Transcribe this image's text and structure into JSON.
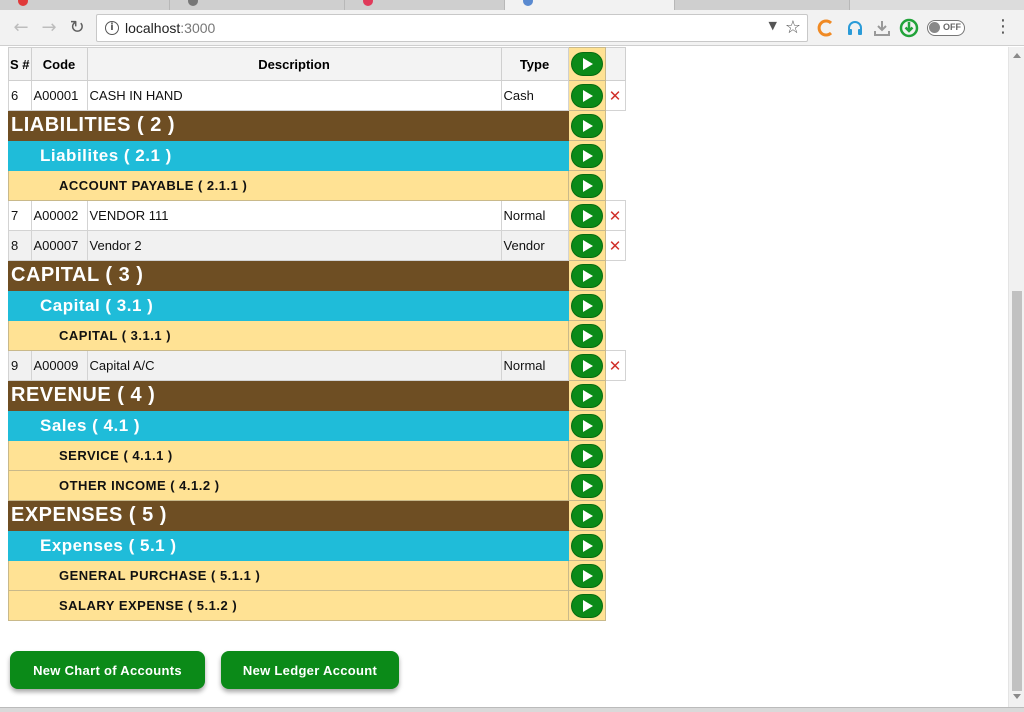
{
  "browser": {
    "url_host": "localhost",
    "url_port": ":3000",
    "toggle_label": "OFF"
  },
  "table": {
    "headers": {
      "sn": "S #",
      "code": "Code",
      "description": "Description",
      "type": "Type"
    },
    "rows": [
      {
        "kind": "account",
        "sn": "6",
        "code": "A00001",
        "description": "CASH IN HAND",
        "type": "Cash",
        "alt": false
      },
      {
        "kind": "level1",
        "label": "LIABILITIES ( 2 )"
      },
      {
        "kind": "level2",
        "label": "Liabilites ( 2.1 )"
      },
      {
        "kind": "level3",
        "label": "ACCOUNT PAYABLE ( 2.1.1 )"
      },
      {
        "kind": "account",
        "sn": "7",
        "code": "A00002",
        "description": "VENDOR 111",
        "type": "Normal",
        "alt": false
      },
      {
        "kind": "account",
        "sn": "8",
        "code": "A00007",
        "description": "Vendor 2",
        "type": "Vendor",
        "alt": true
      },
      {
        "kind": "level1",
        "label": "CAPITAL ( 3 )"
      },
      {
        "kind": "level2",
        "label": "Capital ( 3.1 )"
      },
      {
        "kind": "level3",
        "label": "CAPITAL ( 3.1.1 )"
      },
      {
        "kind": "account",
        "sn": "9",
        "code": "A00009",
        "description": "Capital A/C",
        "type": "Normal",
        "alt": true
      },
      {
        "kind": "level1",
        "label": "REVENUE ( 4 )"
      },
      {
        "kind": "level2",
        "label": "Sales ( 4.1 )"
      },
      {
        "kind": "level3",
        "label": "SERVICE ( 4.1.1 )"
      },
      {
        "kind": "level3",
        "label": "OTHER INCOME ( 4.1.2 )"
      },
      {
        "kind": "level1",
        "label": "EXPENSES ( 5 )"
      },
      {
        "kind": "level2",
        "label": "Expenses ( 5.1 )"
      },
      {
        "kind": "level3",
        "label": "GENERAL PURCHASE ( 5.1.1 )"
      },
      {
        "kind": "level3",
        "label": "SALARY EXPENSE ( 5.1.2 )"
      }
    ]
  },
  "actions": {
    "new_chart": "New Chart of Accounts",
    "new_ledger": "New Ledger Account"
  },
  "colors": {
    "level1_bg": "#6e4e23",
    "level2_bg": "#1fbcd9",
    "level3_bg": "#ffe294",
    "accent_green": "#0b8a18",
    "delete_red": "#d0302a"
  },
  "icons": {
    "open_row": "play-icon",
    "delete_row": "delete-x-icon"
  }
}
